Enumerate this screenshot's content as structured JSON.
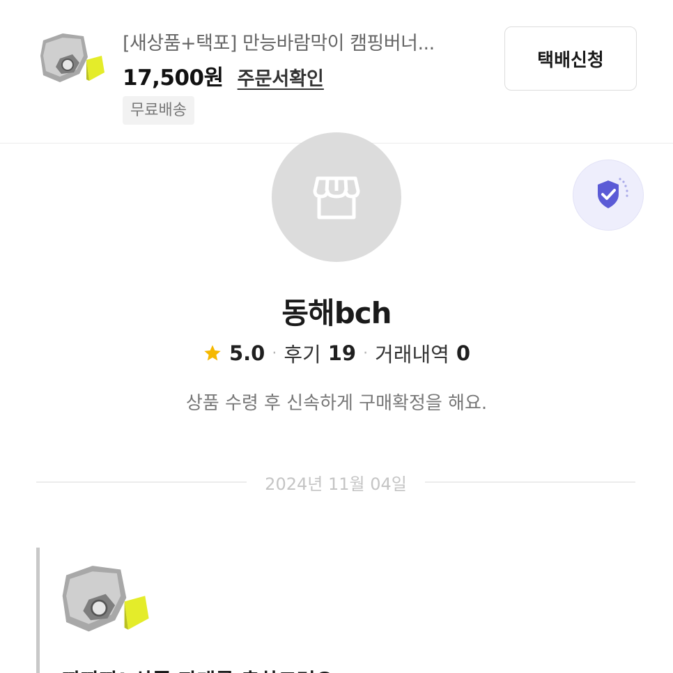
{
  "product": {
    "image_icon": "product-photo-camping-windshield",
    "title": "[새상품+택포] 만능바람막이 캠핑버너...",
    "price": "17,500원",
    "order_link": "주문서확인",
    "shipping_badge": "무료배송",
    "delivery_button": "택배신청"
  },
  "store": {
    "avatar_icon": "store-icon",
    "verify_icon": "shield-check-icon",
    "name": "동해bch",
    "rating": "5.0",
    "review_label": "후기",
    "review_count": "19",
    "trade_label": "거래내역",
    "trade_count": "0",
    "intro": "상품 수령 후 신속하게 구매확정을 해요."
  },
  "chat": {
    "date": "2024년 11월 04일",
    "message_text": "짜짜짜! 상품 판매를 축하드려요."
  },
  "colors": {
    "accent_star": "#f5b800",
    "verify_shield": "#5b5bd6",
    "verify_bg": "#eeeefc"
  }
}
